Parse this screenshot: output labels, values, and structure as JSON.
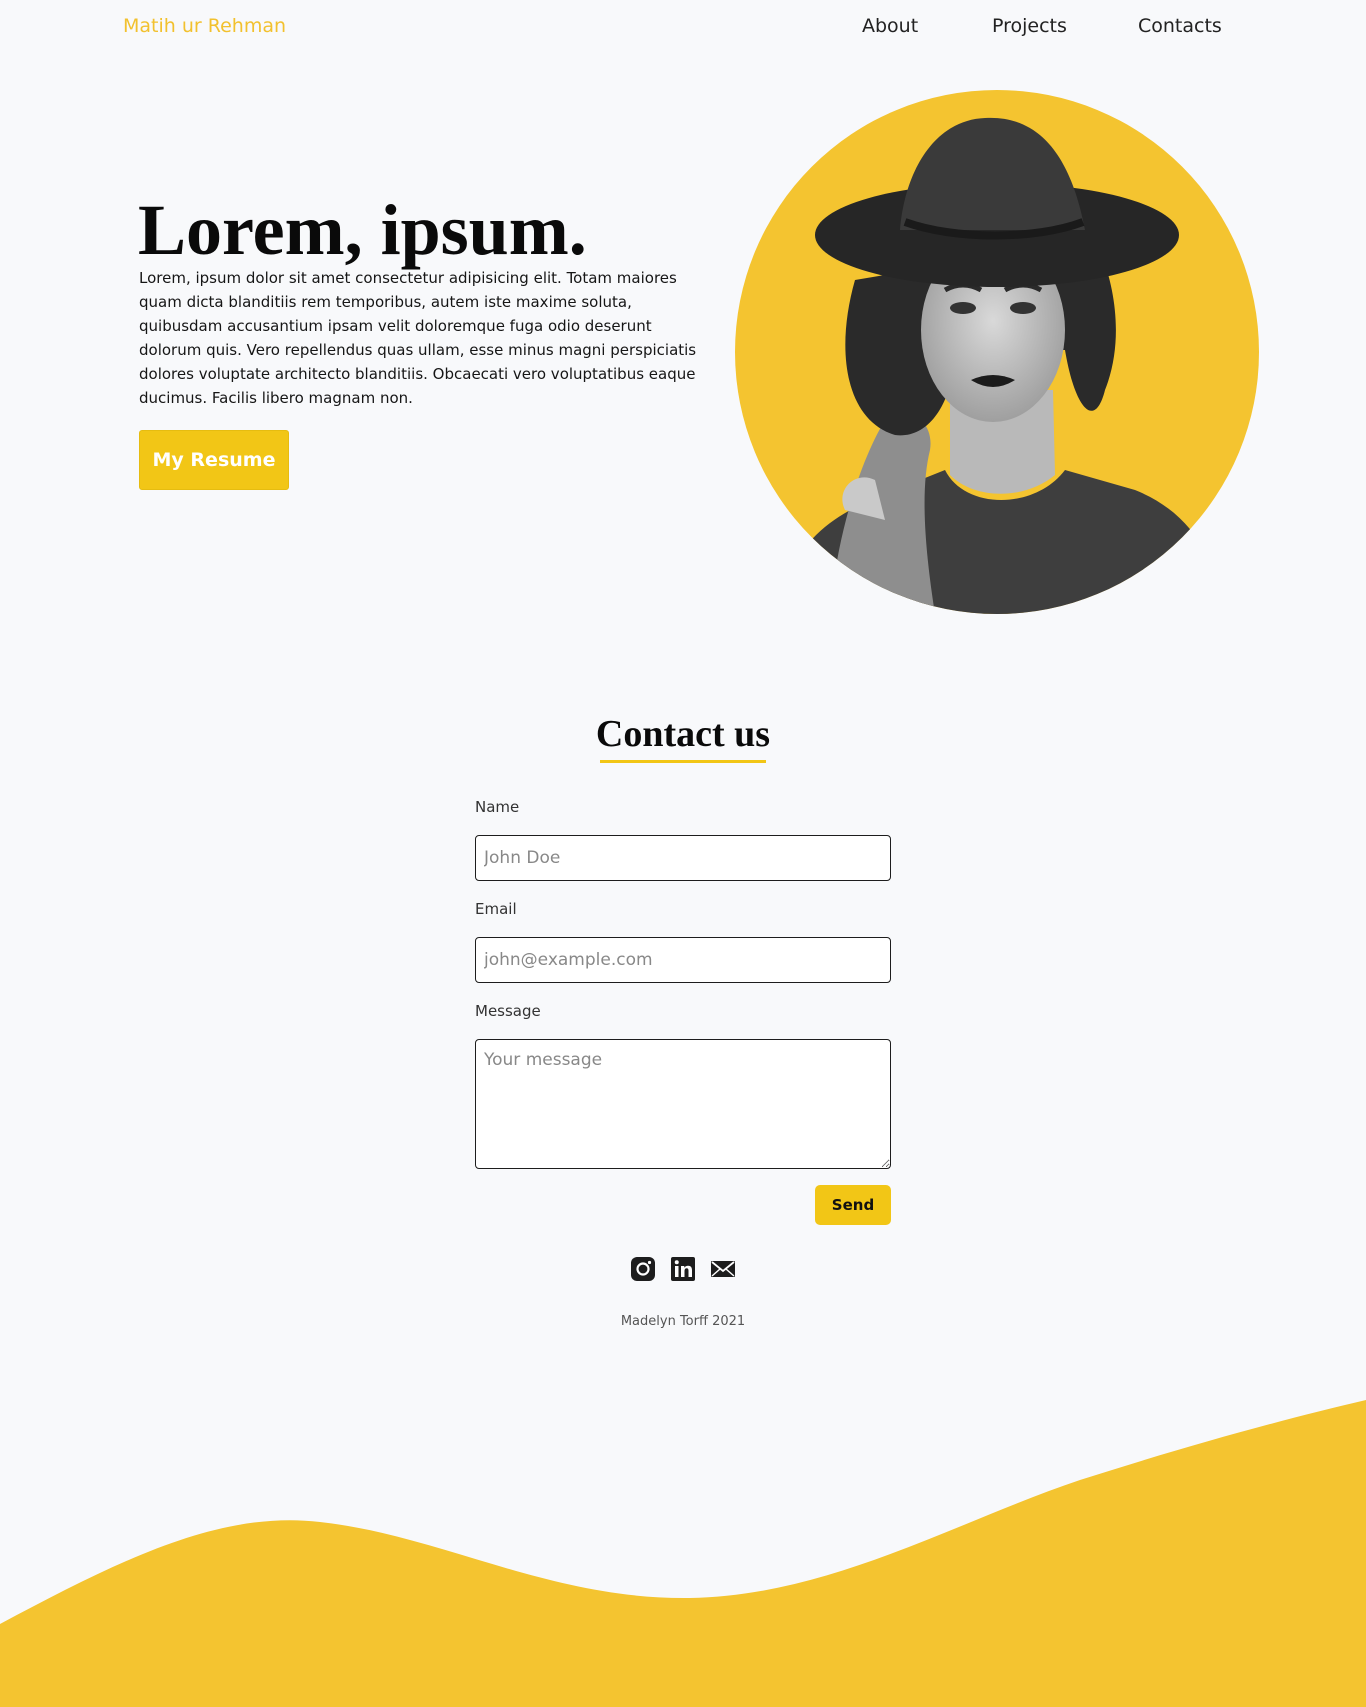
{
  "header": {
    "logo": "Matih ur Rehman",
    "nav": [
      "About",
      "Projects",
      "Contacts"
    ]
  },
  "hero": {
    "title": "Lorem, ipsum.",
    "text": "Lorem, ipsum dolor sit amet consectetur adipisicing elit. Totam maiores quam dicta blanditiis rem temporibus, autem iste maxime soluta, quibusdam accusantium ipsam velit doloremque fuga odio deserunt dolorum quis. Vero repellendus quas ullam, esse minus magni perspiciatis dolores voluptate architecto blanditiis. Obcaecati vero voluptatibus eaque ducimus. Facilis libero magnam non.",
    "button": "My Resume"
  },
  "contact": {
    "title": "Contact us",
    "name_label": "Name",
    "name_placeholder": "John Doe",
    "email_label": "Email",
    "email_placeholder": "john@example.com",
    "message_label": "Message",
    "message_placeholder": "Your message",
    "send": "Send"
  },
  "socials": [
    "instagram-icon",
    "linkedin-icon",
    "mail-icon"
  ],
  "footer": {
    "text": "Madelyn Torff 2021"
  },
  "colors": {
    "accent": "#f2c12e",
    "button": "#f2c616",
    "background": "#f8f9fb"
  }
}
